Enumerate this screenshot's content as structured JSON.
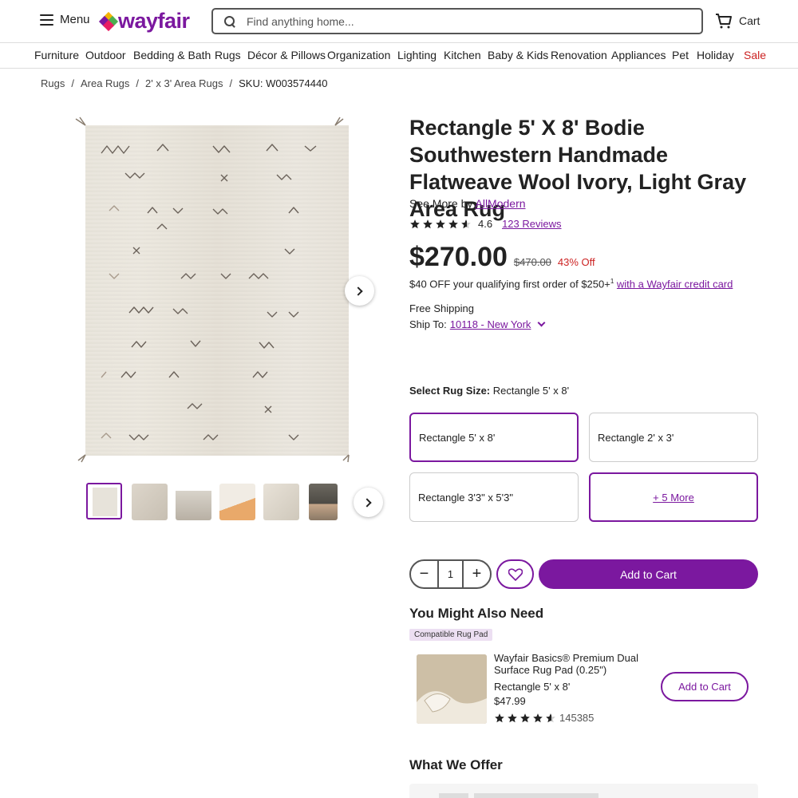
{
  "header": {
    "menu_label": "Menu",
    "logo_text": "wayfair",
    "search_placeholder": "Find anything home...",
    "cart_label": "Cart"
  },
  "nav": {
    "items": [
      "Furniture",
      "Outdoor",
      "Bedding & Bath",
      "Rugs",
      "Décor & Pillows",
      "Organization",
      "Lighting",
      "Kitchen",
      "Baby & Kids",
      "Renovation",
      "Appliances",
      "Pet",
      "Holiday",
      "Sale"
    ]
  },
  "breadcrumb": {
    "items": [
      "Rugs",
      "Area Rugs",
      "2' x 3' Area Rugs"
    ],
    "sku": "SKU: W003574440"
  },
  "product": {
    "title": "Rectangle 5' X 8' Bodie Southwestern Handmade Flatweave Wool Ivory, Light Gray Area Rug",
    "see_more_prefix": "See More by",
    "brand": "AllModern",
    "rating": "4.6",
    "rating_value": 4.6,
    "reviews": "123 Reviews",
    "price": "$270.00",
    "old_price": "$470.00",
    "discount": "43% Off",
    "promo_text": "$40 OFF your qualifying first order of $250+",
    "promo_sup": "1",
    "promo_link": "with a Wayfair credit card",
    "shipping": "Free Shipping",
    "ship_to_label": "Ship To:",
    "ship_to_value": "10118 - New York"
  },
  "size": {
    "label": "Select Rug Size:",
    "selected": "Rectangle 5' x 8'",
    "options": [
      "Rectangle 5' x 8'",
      "Rectangle 2' x 3'",
      "Rectangle 3'3\" x 5'3\"",
      "+ 5 More"
    ]
  },
  "purchase": {
    "quantity": "1",
    "minus": "−",
    "plus": "+",
    "add_to_cart": "Add to Cart"
  },
  "recommendations": {
    "heading": "You Might Also Need",
    "badge": "Compatible Rug Pad",
    "item": {
      "name": "Wayfair Basics® Premium Dual Surface Rug Pad (0.25\")",
      "size": "Rectangle 5' x 8'",
      "price": "$47.99",
      "rating_value": 4.6,
      "reviews": "145385",
      "add_to_cart": "Add to Cart"
    }
  },
  "offer": {
    "heading": "What We Offer"
  },
  "colors": {
    "brand": "#7b189f",
    "sale": "#cc2222"
  }
}
